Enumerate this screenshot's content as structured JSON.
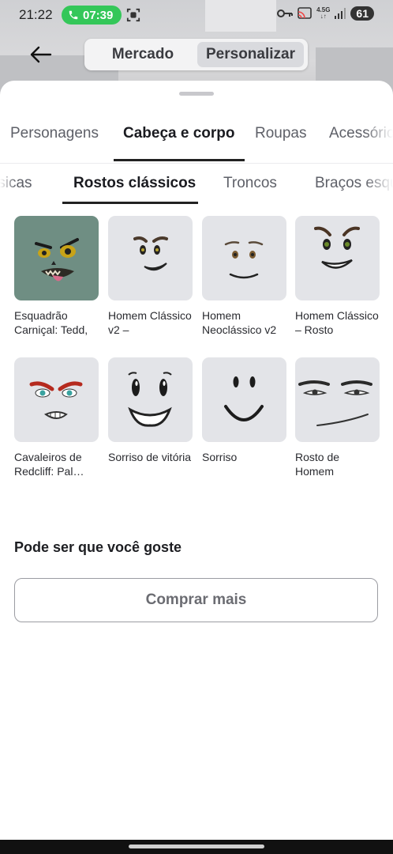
{
  "status_bar": {
    "time": "21:22",
    "call_time": "07:39",
    "network_top": "4.5G",
    "network_bottom": "↓↑",
    "battery": "61"
  },
  "header": {
    "segments": [
      "Mercado",
      "Personalizar"
    ],
    "active_segment": "Personalizar"
  },
  "tabs": [
    "Personagens",
    "Cabeça e corpo",
    "Roupas",
    "Acessórios"
  ],
  "active_tab": "Cabeça e corpo",
  "subtabs": [
    "Básicas",
    "Rostos clássicos",
    "Troncos",
    "Braços esquerdos"
  ],
  "active_subtab": "Rostos clássicos",
  "items": [
    {
      "name": "Esquadrão Carniçal: Tedd,",
      "face": "zombie-face"
    },
    {
      "name": "Homem Clássico v2 –",
      "face": "classic-man-v2-face"
    },
    {
      "name": "Homem Neoclássico v2",
      "face": "neoclassic-man-face"
    },
    {
      "name": "Homem Clássico – Rosto",
      "face": "classic-man-face"
    },
    {
      "name": "Cavaleiros de Redcliff: Pal…",
      "face": "redcliff-knight-face"
    },
    {
      "name": "Sorriso de vitória",
      "face": "winning-smile-face"
    },
    {
      "name": "Sorriso",
      "face": "smile-face"
    },
    {
      "name": "Rosto de Homem",
      "face": "man-face"
    }
  ],
  "recommend_title": "Pode ser que você goste",
  "shop_more_label": "Comprar mais",
  "colors": {
    "accent_green": "#34c759",
    "thumb_bg": "#e3e4e8",
    "zombie_bg": "#6f8e83"
  }
}
